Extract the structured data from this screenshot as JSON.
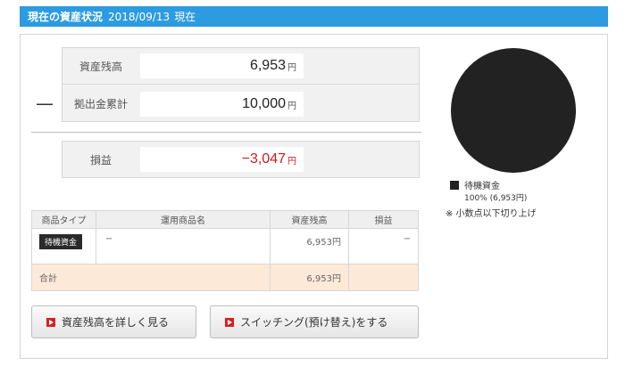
{
  "header": {
    "title": "現在の資産状況",
    "date": "2018/09/13",
    "suffix": "現在"
  },
  "summary": {
    "balance_label": "資産残高",
    "balance_value": "6,953",
    "contrib_label": "拠出金累計",
    "contrib_value": "10,000",
    "dash": "—",
    "pl_label": "損益",
    "pl_value": "−3,047",
    "unit": "円"
  },
  "table": {
    "headers": [
      "商品タイプ",
      "運用商品名",
      "資産残高",
      "損益"
    ],
    "row": {
      "type": "待機資金",
      "name": "−",
      "balance": "6,953円",
      "pl": "−"
    },
    "total": {
      "label": "合計",
      "balance": "6,953円"
    }
  },
  "buttons": {
    "detail": "資産残高を詳しく見る",
    "switching": "スイッチング(預け替え)をする"
  },
  "chart_data": {
    "type": "pie",
    "categories": [
      "待機資金"
    ],
    "values": [
      100
    ],
    "legend": [
      {
        "name": "待機資金",
        "detail": "100% (6,953円)"
      }
    ],
    "colors": [
      "#222222"
    ]
  },
  "note": "※ 小数点以下切り上げ"
}
